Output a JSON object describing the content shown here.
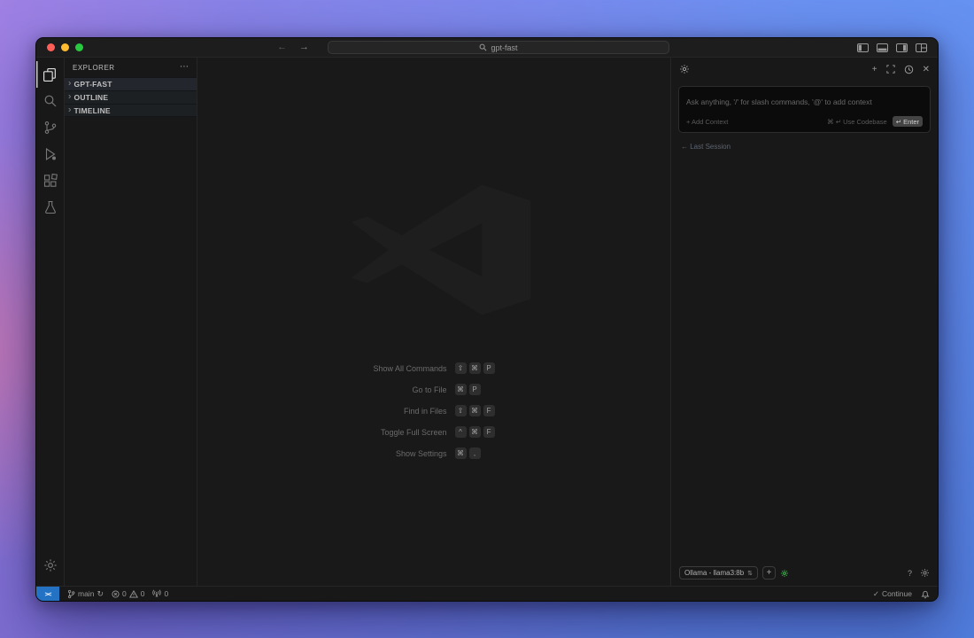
{
  "colors": {
    "accent_blue": "#2472c4",
    "success_green": "#3fb950",
    "traffic_red": "#ff5f57",
    "traffic_yellow": "#febc2e",
    "traffic_green": "#28c840"
  },
  "titlebar": {
    "search_text": "gpt-fast"
  },
  "icons": {
    "back": "←",
    "forward": "→",
    "more": "⋯",
    "chevron_right": "›",
    "plus": "+",
    "close": "✕",
    "check": "✓",
    "question": "?",
    "updown": "⇅",
    "sync": "↻"
  },
  "sidebar": {
    "title": "EXPLORER",
    "sections": [
      {
        "label": "GPT-FAST"
      },
      {
        "label": "OUTLINE"
      },
      {
        "label": "TIMELINE"
      }
    ]
  },
  "editor": {
    "shortcuts": [
      {
        "label": "Show All Commands",
        "keys": [
          "⇧",
          "⌘",
          "P"
        ]
      },
      {
        "label": "Go to File",
        "keys": [
          "⌘",
          "P"
        ]
      },
      {
        "label": "Find in Files",
        "keys": [
          "⇧",
          "⌘",
          "F"
        ]
      },
      {
        "label": "Toggle Full Screen",
        "keys": [
          "^",
          "⌘",
          "F"
        ]
      },
      {
        "label": "Show Settings",
        "keys": [
          "⌘",
          ","
        ]
      }
    ]
  },
  "chat_panel": {
    "input_placeholder": "Ask anything, '/' for slash commands, '@' to add context",
    "add_context_label": "+ Add Context",
    "use_codebase_label": "⌘ ↵ Use Codebase",
    "enter_label": "↵ Enter",
    "last_session_label": "← Last Session",
    "model_label": "Ollama - llama3:8b"
  },
  "statusbar": {
    "remote_glyph": "><",
    "branch": "main",
    "errors": "0",
    "warnings": "0",
    "ports": "0",
    "continue_label": "Continue"
  }
}
